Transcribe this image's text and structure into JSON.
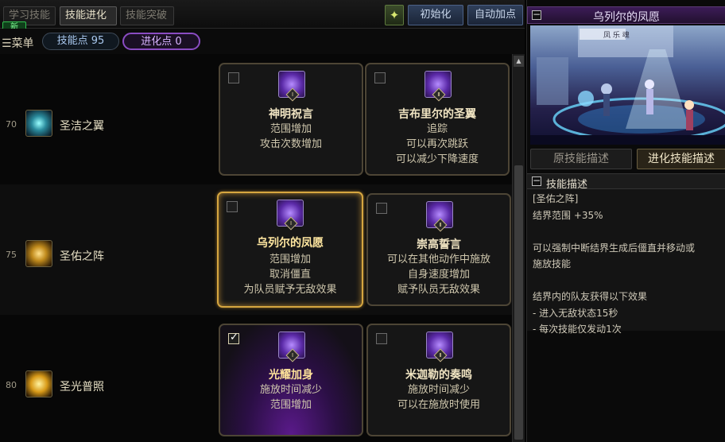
{
  "tabs": [
    {
      "label": "学习技能"
    },
    {
      "label": "技能进化"
    },
    {
      "label": "技能突破"
    }
  ],
  "new_badge": "新",
  "buttons": {
    "initialize": "初始化",
    "auto_add": "自动加点"
  },
  "menu": {
    "label": "菜单",
    "skill_points": "技能点 95",
    "evolution_points": "进化点 0"
  },
  "skills": [
    {
      "level": "70",
      "name": "圣洁之翼",
      "options": [
        {
          "roman": "Ⅰ",
          "title": "神明祝言",
          "lines": [
            "范围增加",
            "攻击次数增加"
          ],
          "checked": false
        },
        {
          "roman": "Ⅱ",
          "title": "吉布里尔的圣翼",
          "lines": [
            "追踪",
            "可以再次跳跃",
            "可以减少下降速度"
          ],
          "checked": false
        }
      ]
    },
    {
      "level": "75",
      "name": "圣佑之阵",
      "options": [
        {
          "roman": "Ⅰ",
          "title": "乌列尔的凤愿",
          "lines": [
            "范围增加",
            "取消僵直",
            "为队员赋予无敌效果"
          ],
          "checked": false
        },
        {
          "roman": "Ⅱ",
          "title": "崇高誓言",
          "lines": [
            "可以在其他动作中施放",
            "自身速度增加",
            "赋予队员无敌效果"
          ],
          "checked": false
        }
      ]
    },
    {
      "level": "80",
      "name": "圣光普照",
      "options": [
        {
          "roman": "Ⅰ",
          "title": "光耀加身",
          "lines": [
            "施放时间减少",
            "范围增加"
          ],
          "checked": true
        },
        {
          "roman": "Ⅱ",
          "title": "米迦勒的奏鸣",
          "lines": [
            "施放时间减少",
            "可以在施放时使用"
          ],
          "checked": false
        }
      ]
    }
  ],
  "right_panel": {
    "title": "乌列尔的凤愿",
    "preview_sign": "凤 乐 魂",
    "tabs": {
      "original": "原技能描述",
      "evolution": "进化技能描述"
    },
    "desc_header": "技能描述",
    "desc_lines": [
      "[圣佑之阵]",
      "结界范围 +35%",
      "",
      "可以强制中断结界生成后僵直并移动或",
      "施放技能",
      "",
      "结界内的队友获得以下效果",
      "- 进入无敌状态15秒",
      "- 每次技能仅发动1次"
    ]
  },
  "colors": {
    "selected_border": "#d6a640",
    "evolution_pill": "#8a4cc2",
    "panel_header": "#3c1c57"
  }
}
